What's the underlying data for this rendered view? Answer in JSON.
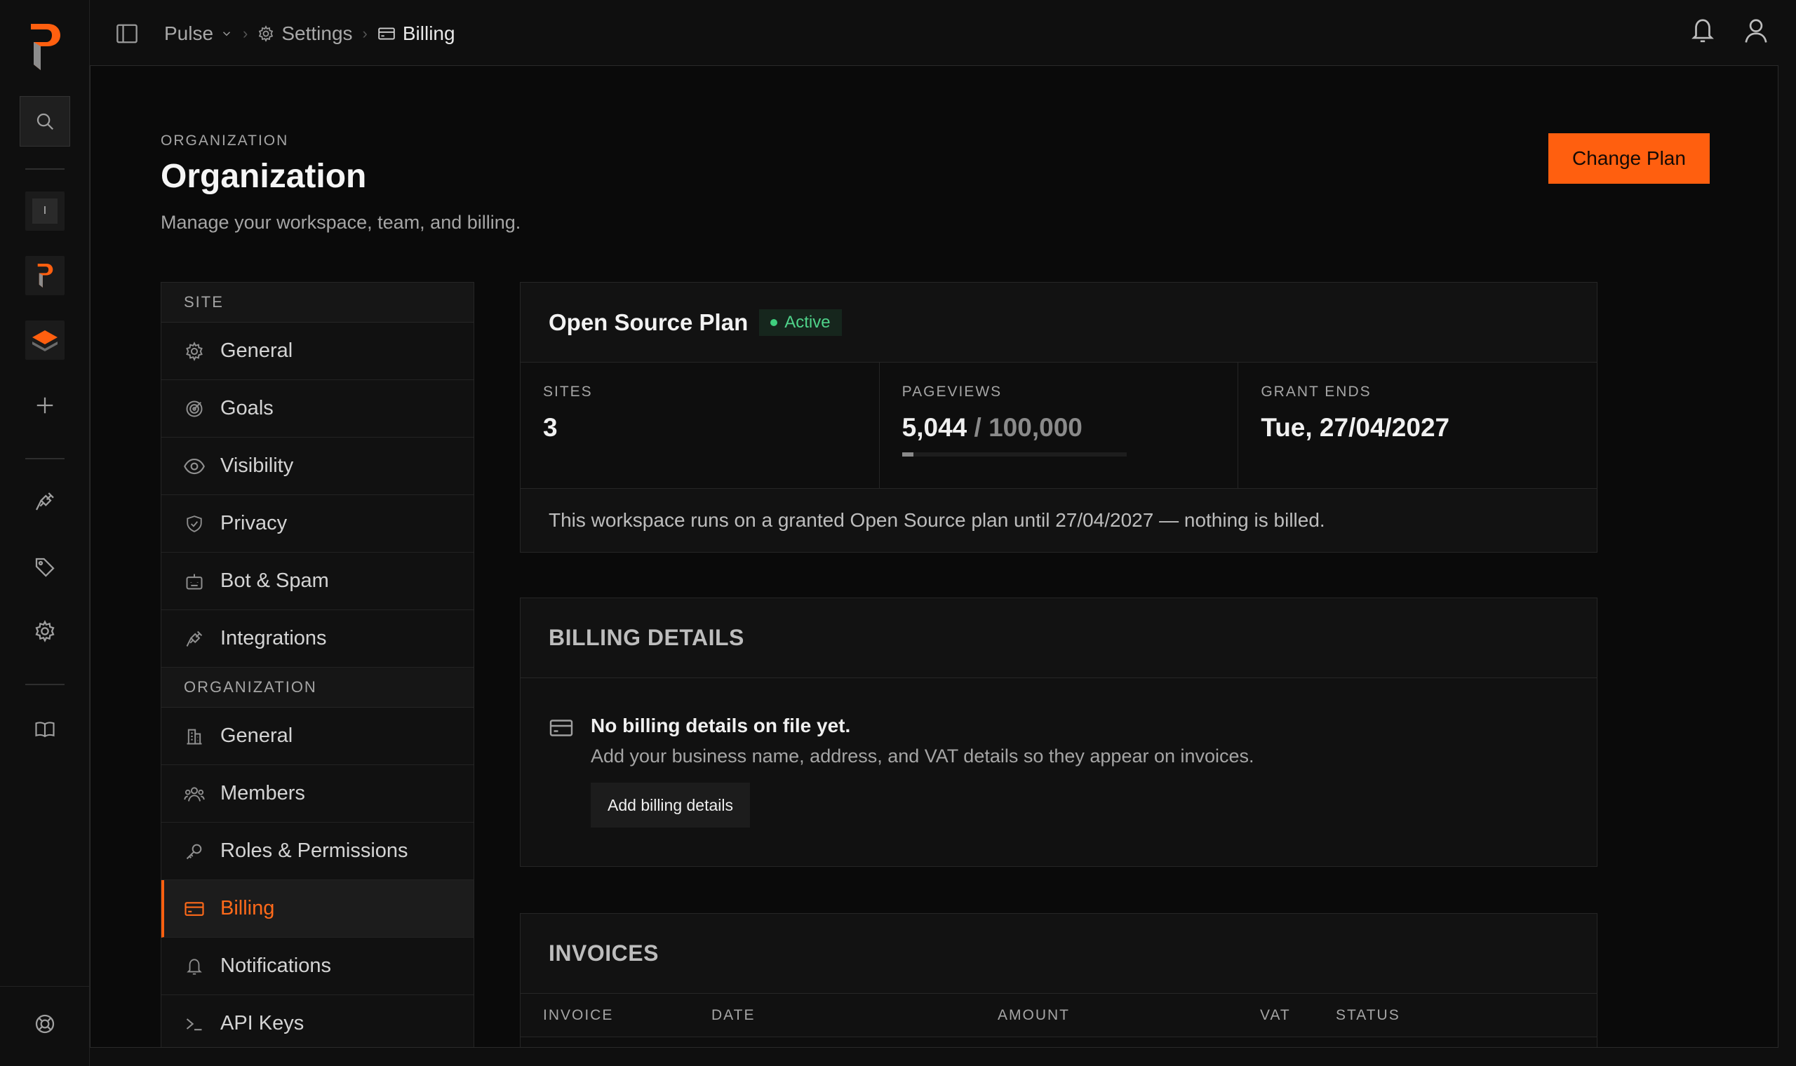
{
  "breadcrumb": {
    "workspace": "Pulse",
    "settings": "Settings",
    "current": "Billing"
  },
  "header": {
    "eyebrow": "ORGANIZATION",
    "title": "Organization",
    "subtitle": "Manage your workspace, team, and billing.",
    "change_plan_label": "Change Plan"
  },
  "rail": {
    "badge_letter": "I"
  },
  "settings_nav": {
    "site_heading": "SITE",
    "site_items": [
      {
        "label": "General",
        "icon": "gear-icon"
      },
      {
        "label": "Goals",
        "icon": "target-icon"
      },
      {
        "label": "Visibility",
        "icon": "eye-icon"
      },
      {
        "label": "Privacy",
        "icon": "shield-icon"
      },
      {
        "label": "Bot & Spam",
        "icon": "bot-icon"
      },
      {
        "label": "Integrations",
        "icon": "plug-icon"
      }
    ],
    "org_heading": "ORGANIZATION",
    "org_items": [
      {
        "label": "General",
        "icon": "building-icon"
      },
      {
        "label": "Members",
        "icon": "users-icon"
      },
      {
        "label": "Roles & Permissions",
        "icon": "key-icon"
      },
      {
        "label": "Billing",
        "icon": "credit-card-icon",
        "active": true
      },
      {
        "label": "Notifications",
        "icon": "bell-icon"
      },
      {
        "label": "API Keys",
        "icon": "terminal-icon"
      }
    ]
  },
  "plan": {
    "name": "Open Source Plan",
    "status": "Active",
    "sites_label": "SITES",
    "sites_value": "3",
    "pageviews_label": "PAGEVIEWS",
    "pageviews_used": "5,044",
    "pageviews_limit": "/ 100,000",
    "pageviews_fraction": 0.05044,
    "grant_label": "GRANT ENDS",
    "grant_value": "Tue, 27/04/2027",
    "note": "This workspace runs on a granted Open Source plan until 27/04/2027 — nothing is billed."
  },
  "billing_details": {
    "title": "BILLING DETAILS",
    "empty_title": "No billing details on file yet.",
    "empty_desc": "Add your business name, address, and VAT details so they appear on invoices.",
    "add_label": "Add billing details"
  },
  "invoices": {
    "title": "INVOICES",
    "columns": [
      "INVOICE",
      "DATE",
      "AMOUNT",
      "VAT",
      "STATUS"
    ]
  },
  "colors": {
    "accent": "#ff5f0f",
    "active_green": "#3fcf7e"
  }
}
